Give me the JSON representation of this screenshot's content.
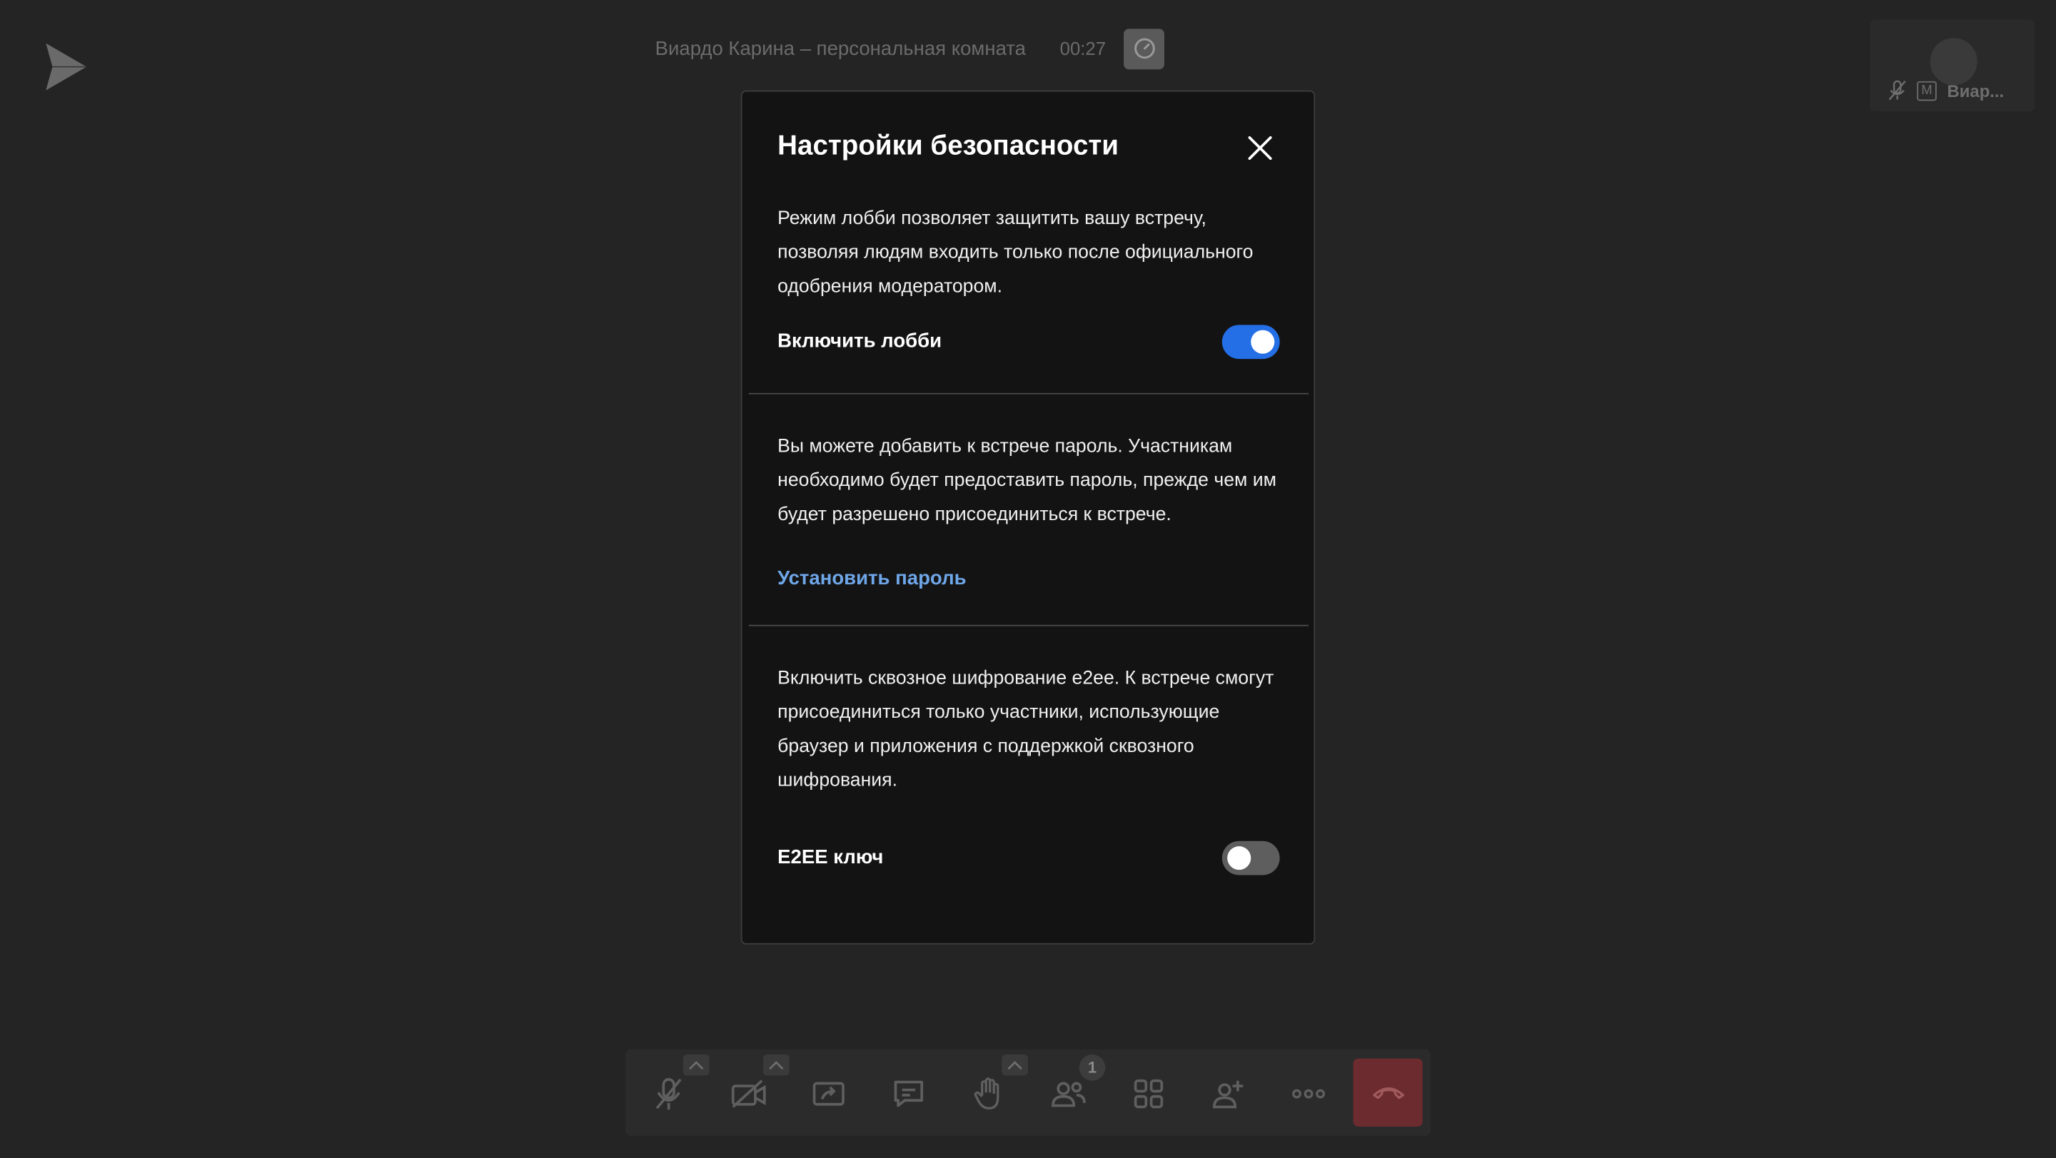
{
  "header": {
    "room_title": "Виардо Карина – персональная комната",
    "timer": "00:27"
  },
  "participant": {
    "name": "Виар...",
    "moderator_badge": "M"
  },
  "modal": {
    "title": "Настройки безопасности",
    "lobby": {
      "description": "Режим лобби позволяет защитить вашу встречу, позволяя людям входить только после официального одобрения модератором.",
      "toggle_label": "Включить лобби",
      "enabled": true
    },
    "password": {
      "description": "Вы можете добавить к встрече пароль. Участникам необходимо будет предоставить пароль, прежде чем им будет разрешено присоединиться к встрече.",
      "link_label": "Установить пароль"
    },
    "e2ee": {
      "description": "Включить сквозное шифрование e2ee. К встрече смогут присоединиться только участники, использующие браузер и приложения с поддержкой сквозного шифрования.",
      "toggle_label": "E2EE ключ",
      "enabled": false
    }
  },
  "toolbar": {
    "participants_count": "1"
  },
  "colors": {
    "accent": "#246fe5",
    "link": "#6ea6e8",
    "hangup": "#6b2b2f"
  }
}
